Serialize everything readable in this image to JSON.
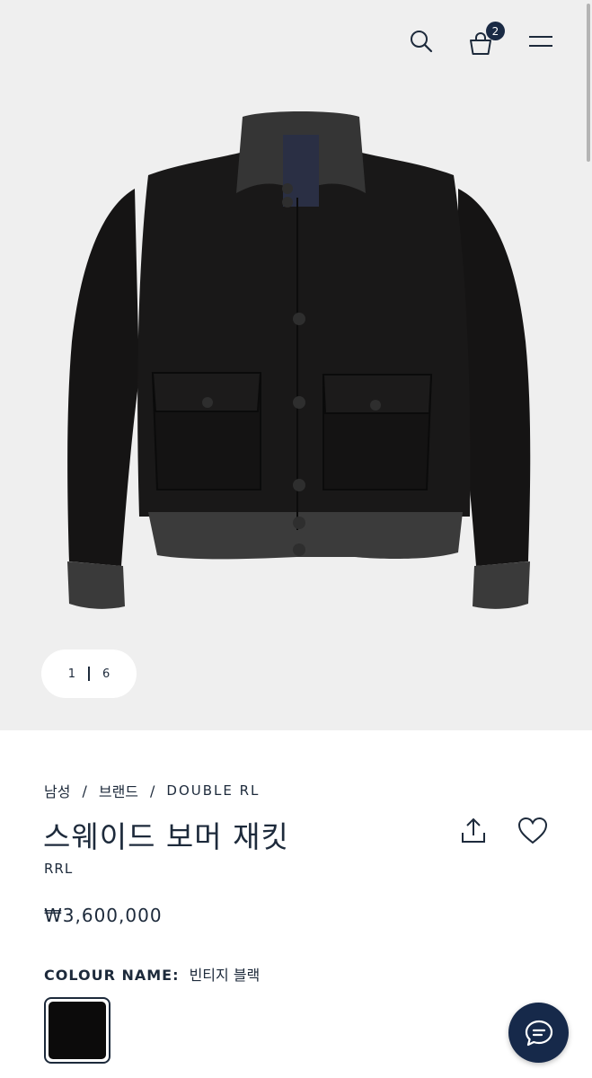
{
  "header": {
    "search_icon": "search-icon",
    "bag_icon": "shopping-bag-icon",
    "bag_count": "2",
    "menu_icon": "hamburger-menu-icon"
  },
  "gallery": {
    "current": "1",
    "total": "6"
  },
  "breadcrumb": {
    "items": [
      "남성",
      "브랜드",
      "DOUBLE RL"
    ],
    "separator": "/"
  },
  "product": {
    "title": "스웨이드 보머 재킷",
    "brand": "RRL",
    "price": "₩3,600,000"
  },
  "colour": {
    "label": "COLOUR NAME:",
    "value": "빈티지 블랙",
    "swatch_color": "#0c0b0b"
  },
  "actions": {
    "share_icon": "share-icon",
    "favorite_icon": "heart-icon",
    "chat_icon": "chat-icon"
  },
  "colors": {
    "navy": "#1d2a3b",
    "hero_bg": "#efefef",
    "chat_bg": "#16294a"
  }
}
